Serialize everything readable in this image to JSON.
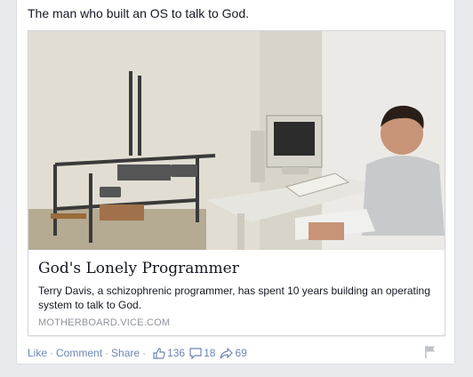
{
  "post": {
    "message": "The man who built an OS to talk to God."
  },
  "card": {
    "title": "God's Lonely Programmer",
    "description": "Terry Davis, a schizophrenic programmer, has spent 10 years building an operating system to talk to God.",
    "domain": "MOTHERBOARD.VICE.COM"
  },
  "actions": {
    "like_label": "Like",
    "comment_label": "Comment",
    "share_label": "Share",
    "separator": "·",
    "likes_count": "136",
    "comments_count": "18",
    "shares_count": "69"
  },
  "icons": {
    "like": "thumbs-up-icon",
    "comment": "comment-bubble-icon",
    "share": "share-arrow-icon",
    "flag": "flag-icon"
  },
  "colors": {
    "link": "#6d84b4",
    "background": "#e9eaed",
    "muted": "#90949c"
  }
}
